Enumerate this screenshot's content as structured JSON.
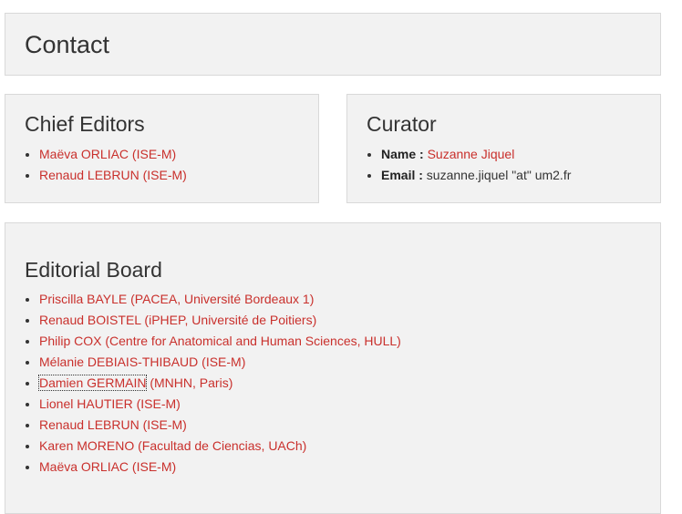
{
  "contact": {
    "title": "Contact"
  },
  "chief_editors": {
    "title": "Chief Editors",
    "items": [
      {
        "label": "Maëva ORLIAC (ISE-M)"
      },
      {
        "label": "Renaud LEBRUN (ISE-M)"
      }
    ]
  },
  "curator": {
    "title": "Curator",
    "name_label": "Name :",
    "name_value": "Suzanne Jiquel",
    "email_label": "Email :",
    "email_value": "suzanne.jiquel \"at\" um2.fr"
  },
  "editorial_board": {
    "title": "Editorial Board",
    "items": [
      {
        "label": "Priscilla BAYLE (PACEA, Université Bordeaux 1)"
      },
      {
        "label": "Renaud BOISTEL (iPHEP, Université de Poitiers)"
      },
      {
        "label": "Philip COX (Centre for Anatomical and Human Sciences, HULL)"
      },
      {
        "label": "Mélanie DEBIAIS-THIBAUD (ISE-M)"
      },
      {
        "label": "Damien GERMAIN",
        "suffix": " (MNHN, Paris)"
      },
      {
        "label": "Lionel HAUTIER (ISE-M)"
      },
      {
        "label": "Renaud LEBRUN (ISE-M)"
      },
      {
        "label": "Karen MORENO (Facultad de Ciencias, UACh)"
      },
      {
        "label": "Maëva ORLIAC (ISE-M)"
      }
    ]
  },
  "colors": {
    "link": "#c9302c",
    "panel_background": "#f2f2f2",
    "panel_border": "#d9d9d9",
    "text": "#333333"
  }
}
